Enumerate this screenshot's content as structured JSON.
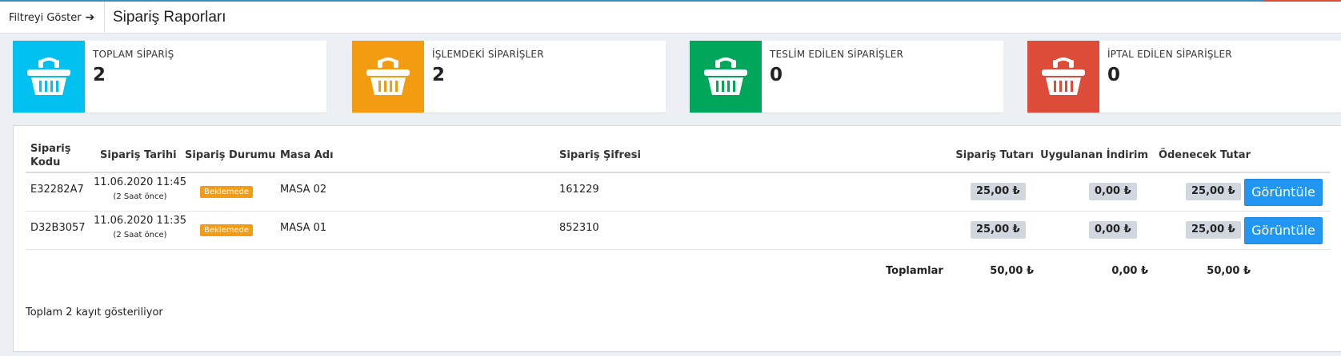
{
  "header": {
    "filter_label": "Filtreyi Göster",
    "filter_arrow": "➔",
    "title": "Sipariş Raporları"
  },
  "stats": [
    {
      "label": "TOPLAM SİPARİŞ",
      "value": "2",
      "color": "#00c0ef",
      "icon": "basket-icon"
    },
    {
      "label": "İŞLEMDEKİ SİPARİŞLER",
      "value": "2",
      "color": "#f39c12",
      "icon": "basket-icon"
    },
    {
      "label": "TESLİM EDİLEN SİPARİŞLER",
      "value": "0",
      "color": "#00a65a",
      "icon": "basket-icon"
    },
    {
      "label": "İPTAL EDİLEN SİPARİŞLER",
      "value": "0",
      "color": "#dd4b39",
      "icon": "basket-icon"
    }
  ],
  "table": {
    "columns": {
      "code_1": "Sipariş",
      "code_2": "Kodu",
      "date": "Sipariş Tarihi",
      "status": "Sipariş Durumu",
      "table_name": "Masa Adı",
      "password": "Sipariş Şifresi",
      "amount": "Sipariş Tutarı",
      "discount": "Uygulanan İndirim",
      "payable": "Ödenecek Tutar"
    },
    "rows": [
      {
        "code": "E32282A7",
        "date": "11.06.2020 11:45",
        "ago": "(2 Saat önce)",
        "status": "Beklemede",
        "table_name": "MASA 02",
        "password": "161229",
        "amount": "25,00 ₺",
        "discount": "0,00 ₺",
        "payable": "25,00 ₺",
        "action": "Görüntüle"
      },
      {
        "code": "D32B3057",
        "date": "11.06.2020 11:35",
        "ago": "(2 Saat önce)",
        "status": "Beklemede",
        "table_name": "MASA 01",
        "password": "852310",
        "amount": "25,00 ₺",
        "discount": "0,00 ₺",
        "payable": "25,00 ₺",
        "action": "Görüntüle"
      }
    ],
    "totals": {
      "label": "Toplamlar",
      "amount": "50,00 ₺",
      "discount": "0,00 ₺",
      "payable": "50,00 ₺"
    },
    "footer": "Toplam 2 kayıt gösteriliyor"
  }
}
